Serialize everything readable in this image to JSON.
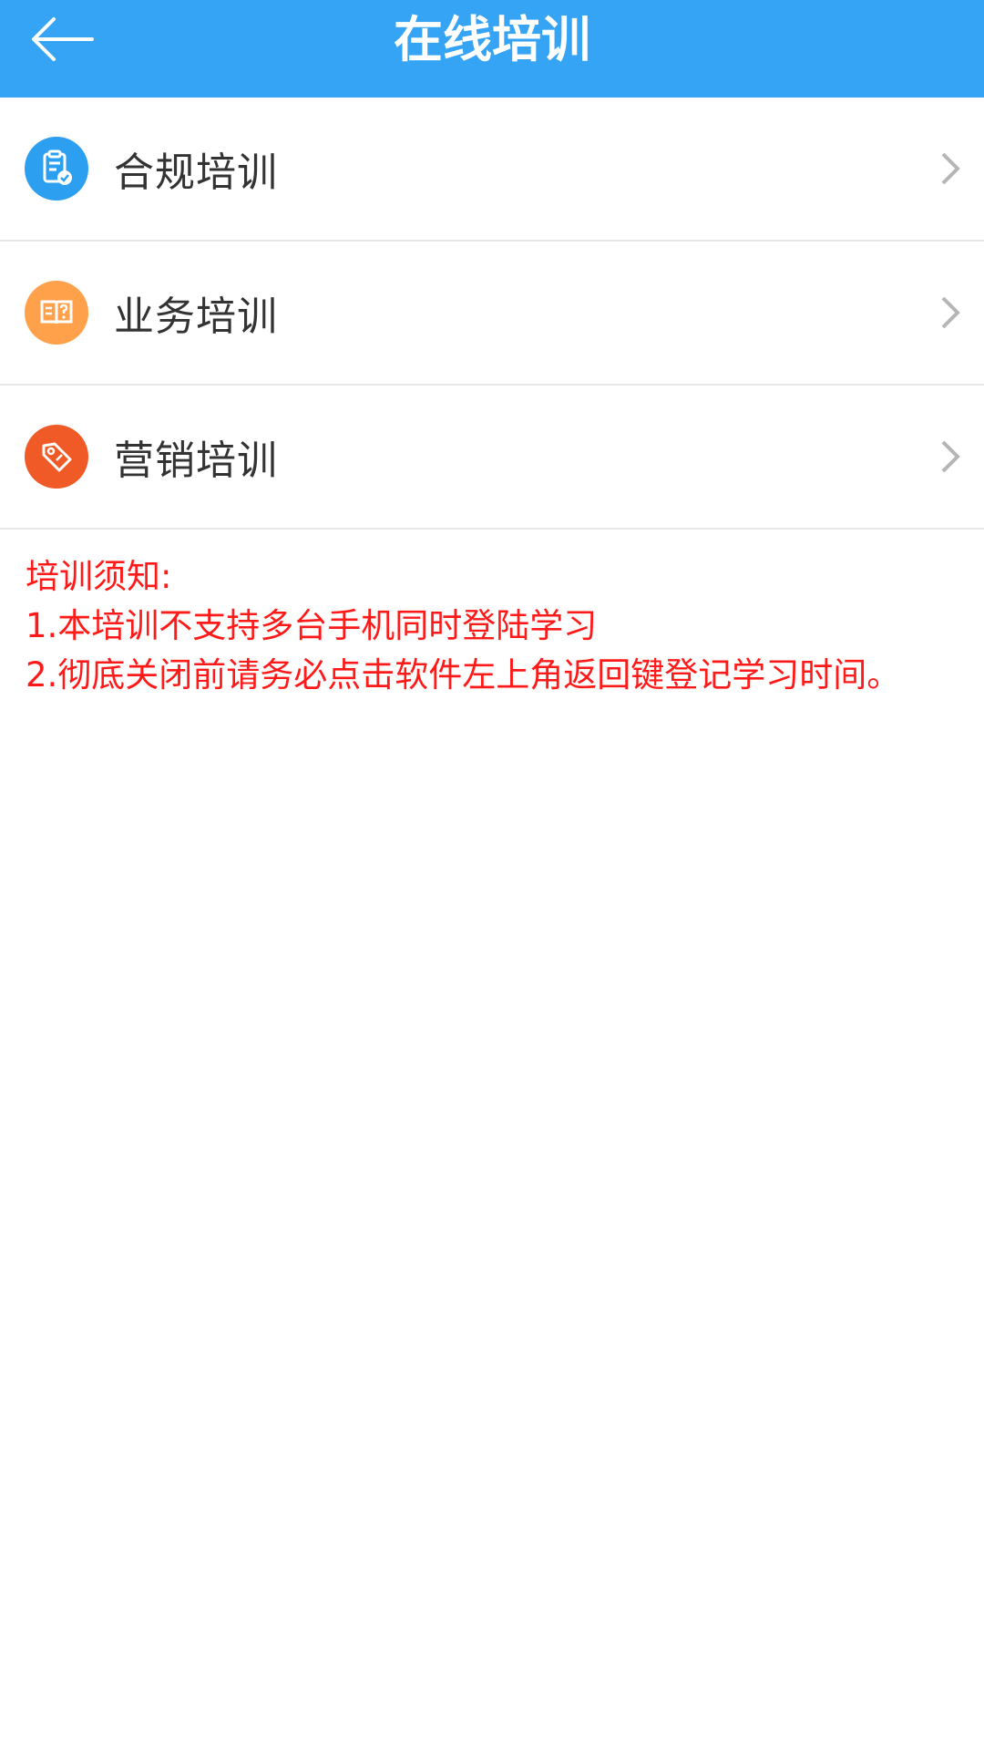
{
  "header": {
    "title": "在线培训"
  },
  "colors": {
    "header_bg": "#35a4f5",
    "notice_text": "#ff1a1a",
    "compliance_icon_bg": "#2d9ff0",
    "business_icon_bg": "#ffa04a",
    "marketing_icon_bg": "#ef5a26"
  },
  "menu": {
    "items": [
      {
        "label": "合规培训",
        "icon": "clipboard-check-icon"
      },
      {
        "label": "业务培训",
        "icon": "book-icon"
      },
      {
        "label": "营销培训",
        "icon": "tag-icon"
      }
    ]
  },
  "notice": {
    "heading": "培训须知:",
    "line1": "1.本培训不支持多台手机同时登陆学习",
    "line2": "2.彻底关闭前请务必点击软件左上角返回键登记学习时间。"
  }
}
